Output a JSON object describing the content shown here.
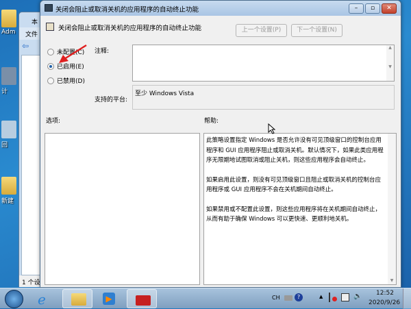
{
  "desktop": {
    "icons": [
      {
        "label": "Adm"
      },
      {
        "label": "计"
      },
      {
        "label": "回"
      },
      {
        "label": "新建"
      }
    ]
  },
  "explorer": {
    "title": "本",
    "menu_file": "文件",
    "status": "1 个设"
  },
  "dialog": {
    "title": "关闭会阻止或取消关机的应用程序的自动终止功能",
    "heading": "关闭会阻止或取消关机的应用程序的自动终止功能",
    "prev_button": "上一个设置(P)",
    "next_button": "下一个设置(N)",
    "radios": [
      {
        "label": "未配置(C)",
        "checked": false
      },
      {
        "label": "已启用(E)",
        "checked": true
      },
      {
        "label": "已禁用(D)",
        "checked": false
      }
    ],
    "comment_label": "注释:",
    "platform_label": "支持的平台:",
    "platform_value": "至少 Windows Vista",
    "options_label": "选项:",
    "help_label": "帮助:",
    "help_paragraphs": [
      "此策略设置指定 Windows 是否允许没有可见顶级窗口的控制台应用程序和 GUI 应用程序阻止或取消关机。默认情况下，如果此类应用程序无限期地试图取消或阻止关机，则这些应用程序会自动终止。",
      "如果启用此设置，则没有可见顶级窗口且阻止或取消关机的控制台应用程序或 GUI 应用程序不会在关机期间自动终止。",
      "如果禁用或不配置此设置，则这些应用程序将在关机期间自动终止，从而有助于确保 Windows 可以更快速、更顺利地关机。"
    ]
  },
  "taskbar": {
    "lang": "CH",
    "time": "12:52",
    "date": "2020/9/26"
  },
  "colors": {
    "arrow": "#e02020",
    "title_bar": "#b9d1ea",
    "desktop": "#1d6fb8"
  }
}
